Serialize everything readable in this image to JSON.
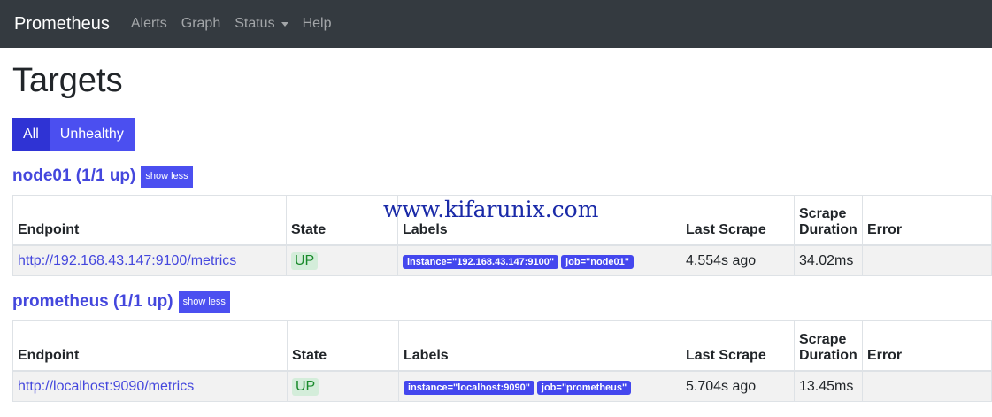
{
  "navbar": {
    "brand": "Prometheus",
    "links": [
      "Alerts",
      "Graph",
      "Status",
      "Help"
    ]
  },
  "page": {
    "title": "Targets",
    "filters": [
      "All",
      "Unhealthy"
    ]
  },
  "table_headers": {
    "endpoint": "Endpoint",
    "state": "State",
    "labels": "Labels",
    "last_scrape": "Last Scrape",
    "scrape_duration_line1": "Scrape",
    "scrape_duration_line2": "Duration",
    "error": "Error"
  },
  "jobs": [
    {
      "title": "node01 (1/1 up)",
      "toggle": "show less",
      "endpoint": "http://192.168.43.147:9100/metrics",
      "state": "UP",
      "labels": [
        "instance=\"192.168.43.147:9100\"",
        "job=\"node01\""
      ],
      "last_scrape": "4.554s ago",
      "scrape_duration": "34.02ms",
      "error": ""
    },
    {
      "title": "prometheus (1/1 up)",
      "toggle": "show less",
      "endpoint": "http://localhost:9090/metrics",
      "state": "UP",
      "labels": [
        "instance=\"localhost:9090\"",
        "job=\"prometheus\""
      ],
      "last_scrape": "5.704s ago",
      "scrape_duration": "13.45ms",
      "error": ""
    }
  ],
  "watermark": "www.kifarunix.com",
  "colors": {
    "navbar_bg": "#343a40",
    "accent": "#4447dd",
    "button": "#4b4ff0",
    "button_active": "#2f33d4",
    "state_up_bg": "#d4edda",
    "state_up_text": "#198a2b"
  }
}
